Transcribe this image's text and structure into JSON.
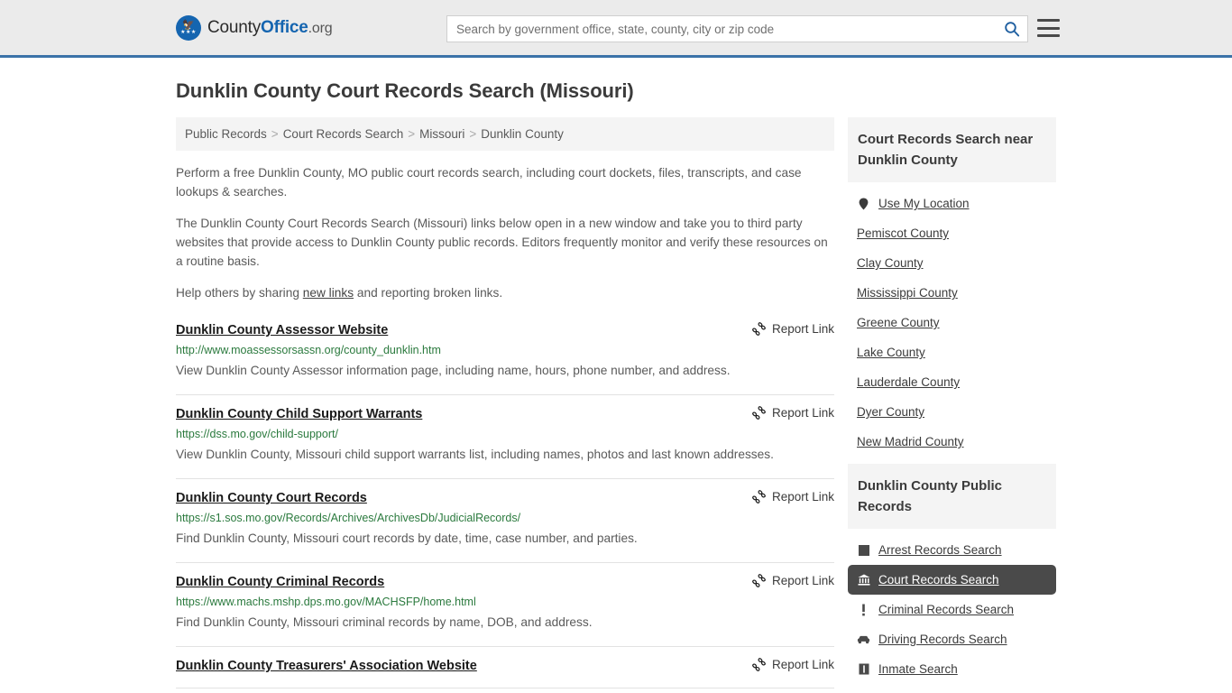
{
  "header": {
    "brand_primary": "County",
    "brand_bold": "Office",
    "brand_tld": ".org",
    "search_placeholder": "Search by government office, state, county, city or zip code",
    "search_value": "",
    "search_icon": "search-icon",
    "menu_icon": "hamburger-menu-icon",
    "accent_color": "#3b72a8",
    "background_color": "#ebebeb"
  },
  "page_title": "Dunklin County Court Records Search (Missouri)",
  "breadcrumb": {
    "separator": ">",
    "items": [
      {
        "label": "Public Records"
      },
      {
        "label": "Court Records Search"
      },
      {
        "label": "Missouri"
      },
      {
        "label": "Dunklin County"
      }
    ]
  },
  "intro": {
    "paragraph1": "Perform a free Dunklin County, MO public court records search, including court dockets, files, transcripts, and case lookups & searches.",
    "paragraph2": "The Dunklin County Court Records Search (Missouri) links below open in a new window and take you to third party websites that provide access to Dunklin County public records. Editors frequently monitor and verify these resources on a routine basis.",
    "paragraph3_before": "Help others by sharing ",
    "paragraph3_link": "new links",
    "paragraph3_after": " and reporting broken links."
  },
  "results": {
    "report_label": "Report Link",
    "report_icon": "broken-link-icon",
    "items": [
      {
        "title": "Dunklin County Assessor Website",
        "url": "http://www.moassessorsassn.org/county_dunklin.htm",
        "description": "View Dunklin County Assessor information page, including name, hours, phone number, and address."
      },
      {
        "title": "Dunklin County Child Support Warrants",
        "url": "https://dss.mo.gov/child-support/",
        "description": "View Dunklin County, Missouri child support warrants list, including names, photos and last known addresses."
      },
      {
        "title": "Dunklin County Court Records",
        "url": "https://s1.sos.mo.gov/Records/Archives/ArchivesDb/JudicialRecords/",
        "description": "Find Dunklin County, Missouri court records by date, time, case number, and parties."
      },
      {
        "title": "Dunklin County Criminal Records",
        "url": "https://www.machs.mshp.dps.mo.gov/MACHSFP/home.html",
        "description": "Find Dunklin County, Missouri criminal records by name, DOB, and address."
      },
      {
        "title": "Dunklin County Treasurers' Association Website",
        "url": "",
        "description": ""
      }
    ]
  },
  "sidebar": {
    "nearby": {
      "title": "Court Records Search near Dunklin County",
      "items": [
        {
          "label": "Use My Location",
          "icon": "map-pin-icon"
        },
        {
          "label": "Pemiscot County",
          "icon": ""
        },
        {
          "label": "Clay County",
          "icon": ""
        },
        {
          "label": "Mississippi County",
          "icon": ""
        },
        {
          "label": "Greene County",
          "icon": ""
        },
        {
          "label": "Lake County",
          "icon": ""
        },
        {
          "label": "Lauderdale County",
          "icon": ""
        },
        {
          "label": "Dyer County",
          "icon": ""
        },
        {
          "label": "New Madrid County",
          "icon": ""
        }
      ]
    },
    "public_records": {
      "title": "Dunklin County Public Records",
      "active_label": "Court Records Search",
      "items": [
        {
          "label": "Arrest Records Search",
          "icon": "fingerprint-icon",
          "active": false
        },
        {
          "label": "Court Records Search",
          "icon": "courthouse-icon",
          "active": true
        },
        {
          "label": "Criminal Records Search",
          "icon": "exclamation-icon",
          "active": false
        },
        {
          "label": "Driving Records Search",
          "icon": "car-icon",
          "active": false
        },
        {
          "label": "Inmate Search",
          "icon": "jail-icon",
          "active": false
        }
      ]
    }
  }
}
